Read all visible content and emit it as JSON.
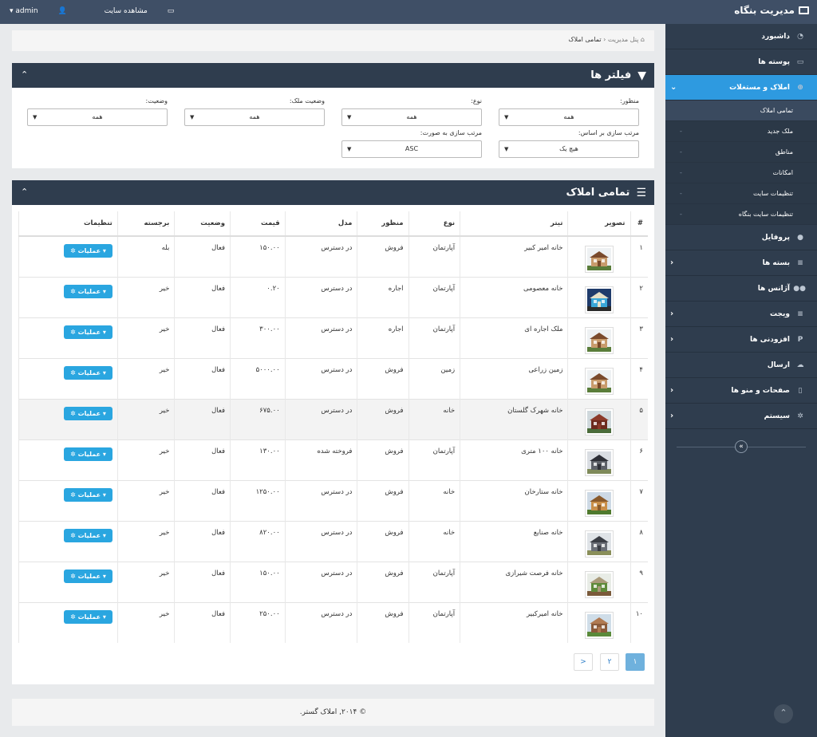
{
  "header": {
    "brand": "مدیریت بنگاه",
    "admin_label": "admin",
    "view_site": "مشاهده سایت"
  },
  "sidebar": {
    "items": [
      {
        "label": "داشبورد",
        "icon": "dashboard-icon"
      },
      {
        "label": "پوسته ها",
        "icon": "monitor-icon"
      },
      {
        "label": "املاک و مستغلات",
        "icon": "plus-circle-icon",
        "active": true
      }
    ],
    "submenu": [
      "تمامی املاک",
      "ملک جدید",
      "مناطق",
      "امکانات",
      "تنظیمات سایت",
      "تنظیمات سایت بنگاه"
    ],
    "items_after": [
      {
        "label": "پروفایل",
        "icon": "user-icon"
      },
      {
        "label": "بسته ها",
        "icon": "list-icon"
      },
      {
        "label": "آژانس ها",
        "icon": "users-icon"
      },
      {
        "label": "ویجت",
        "icon": "list-icon"
      },
      {
        "label": "افزودنی ها",
        "icon": "plug-icon"
      },
      {
        "label": "ارسال",
        "icon": "cloud-icon"
      },
      {
        "label": "صفحات و منو ها",
        "icon": "file-icon"
      },
      {
        "label": "سیستم",
        "icon": "gear-icon"
      }
    ]
  },
  "breadcrumb": {
    "home": "پنل مدیریت",
    "current": "تمامی املاک"
  },
  "filters": {
    "title": "فیلتر ها",
    "manzoor_label": "منظور:",
    "manzoor_value": "همه",
    "type_label": "نوع:",
    "type_value": "همه",
    "status_melk_label": "وضعیت ملک:",
    "status_melk_value": "همه",
    "status_label": "وضعیت:",
    "status_value": "همه",
    "sort_by_label": "مرتب سازی بر اساس:",
    "sort_by_value": "هیچ یک",
    "sort_dir_label": "مرتب سازی به صورت:",
    "sort_dir_value": "ASC"
  },
  "table": {
    "title": "تمامی املاک",
    "headers": [
      "#",
      "تصویر",
      "تیتر",
      "نوع",
      "منظور",
      "مدل",
      "قیمت",
      "وضعیت",
      "برجسته",
      "تنظیمات"
    ],
    "action_label": "عملیات",
    "rows": [
      {
        "num": "۱",
        "title": "خانه امیر کبیر",
        "type": "آپارتمان",
        "purpose": "فروش",
        "model": "در دسترس",
        "price": "۱۵۰.۰۰",
        "status": "فعال",
        "featured": "بله",
        "img": "house-a"
      },
      {
        "num": "۲",
        "title": "خانه معصومی",
        "type": "آپارتمان",
        "purpose": "اجاره",
        "model": "در دسترس",
        "price": "۰.۲۰",
        "status": "فعال",
        "featured": "خیر",
        "img": "pool"
      },
      {
        "num": "۳",
        "title": "ملک اجاره ای",
        "type": "آپارتمان",
        "purpose": "اجاره",
        "model": "در دسترس",
        "price": "۳۰۰.۰۰",
        "status": "فعال",
        "featured": "خیر",
        "img": "house-a"
      },
      {
        "num": "۴",
        "title": "زمین زراعی",
        "type": "زمین",
        "purpose": "فروش",
        "model": "در دسترس",
        "price": "۵۰۰۰.۰۰",
        "status": "فعال",
        "featured": "خیر",
        "img": "house-a"
      },
      {
        "num": "۵",
        "title": "خانه شهرک گلستان",
        "type": "خانه",
        "purpose": "فروش",
        "model": "در دسترس",
        "price": "۶۷۵.۰۰",
        "status": "فعال",
        "featured": "خیر",
        "img": "brick"
      },
      {
        "num": "۶",
        "title": "خانه ۱۰۰ متری",
        "type": "آپارتمان",
        "purpose": "فروش",
        "model": "فروخته شده",
        "price": "۱۳۰.۰۰",
        "status": "فعال",
        "featured": "خیر",
        "img": "victorian"
      },
      {
        "num": "۷",
        "title": "خانه ستارخان",
        "type": "خانه",
        "purpose": "فروش",
        "model": "در دسترس",
        "price": "۱۲۵۰.۰۰",
        "status": "فعال",
        "featured": "خیر",
        "img": "wood"
      },
      {
        "num": "۸",
        "title": "خانه صنایع",
        "type": "خانه",
        "purpose": "فروش",
        "model": "در دسترس",
        "price": "۸۲۰.۰۰",
        "status": "فعال",
        "featured": "خیر",
        "img": "dark"
      },
      {
        "num": "۹",
        "title": "خانه فرصت شیرازی",
        "type": "آپارتمان",
        "purpose": "فروش",
        "model": "در دسترس",
        "price": "۱۵۰.۰۰",
        "status": "فعال",
        "featured": "خیر",
        "img": "garden"
      },
      {
        "num": "۱۰",
        "title": "خانه امیرکبیر",
        "type": "آپارتمان",
        "purpose": "فروش",
        "model": "در دسترس",
        "price": "۲۵۰.۰۰",
        "status": "فعال",
        "featured": "خیر",
        "img": "mansion"
      }
    ]
  },
  "pagination": {
    "pages": [
      "۱",
      "۲"
    ],
    "next": ">"
  },
  "footer": {
    "text": "© ۲۰۱۴, املاک گستر."
  }
}
